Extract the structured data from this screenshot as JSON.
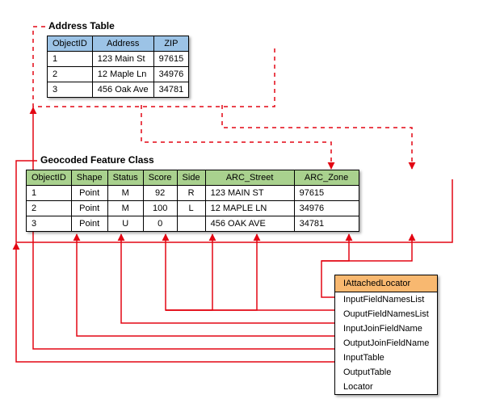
{
  "addressTable": {
    "title": "Address Table",
    "columns": [
      "ObjectID",
      "Address",
      "ZIP"
    ],
    "rows": [
      {
        "id": "1",
        "address": "123 Main St",
        "zip": "97615"
      },
      {
        "id": "2",
        "address": "12 Maple Ln",
        "zip": "34976"
      },
      {
        "id": "3",
        "address": "456 Oak Ave",
        "zip": "34781"
      }
    ]
  },
  "geocodedTable": {
    "title": "Geocoded Feature Class",
    "columns": [
      "ObjectID",
      "Shape",
      "Status",
      "Score",
      "Side",
      "ARC_Street",
      "ARC_Zone"
    ],
    "rows": [
      {
        "id": "1",
        "shape": "Point",
        "status": "M",
        "score": "92",
        "side": "R",
        "street": "123 MAIN ST",
        "zone": "97615"
      },
      {
        "id": "2",
        "shape": "Point",
        "status": "M",
        "score": "100",
        "side": "L",
        "street": "12 MAPLE LN",
        "zone": "34976"
      },
      {
        "id": "3",
        "shape": "Point",
        "status": "U",
        "score": "0",
        "side": "",
        "street": "456 OAK AVE",
        "zone": "34781"
      }
    ]
  },
  "locatorBox": {
    "title": "IAttachedLocator",
    "props": [
      "InputFieldNamesList",
      "OuputFieldNamesList",
      "InputJoinFieldName",
      "OutputJoinFieldName",
      "InputTable",
      "OutputTable",
      "Locator"
    ]
  },
  "colors": {
    "red": "#e30613"
  }
}
